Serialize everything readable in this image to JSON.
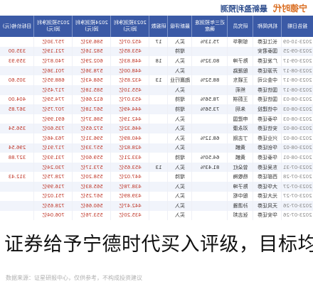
{
  "headline": "证券给予宁德时代买入评级，目标均价",
  "brand": {
    "logo": "宁德时代",
    "subtitle": "最新盈利预测"
  },
  "table": {
    "headers": [
      "报告日期",
      "机构简称",
      "研究员",
      "近三年预测准确度",
      "最新评级",
      "研报数",
      "2023预测净利润(元)",
      "2024预测净利润(元)",
      "2025预测净利润(元)",
      "目标价格(元)"
    ],
    "rows": [
      [
        "2023-10-09",
        "长江证券",
        "邬博华",
        "75.13%",
        "买入",
        "17",
        "452.07亿",
        "586.92亿",
        "757.30亿",
        ""
      ],
      [
        "2023-09-25",
        "国泰君安",
        "",
        "",
        "增持",
        "",
        "453.85亿",
        "582.16亿",
        "721.19亿",
        "335.00"
      ],
      [
        "2023-09-17",
        "广发证券",
        "陈子坤",
        "80.32%",
        "买入",
        "18",
        "448.83亿",
        "602.29亿",
        "740.87亿",
        "359.93"
      ],
      [
        "2023-08-17",
        "开源证券",
        "殷晟路",
        "",
        "买入",
        "",
        "448.00亿",
        "578.36亿",
        "701.36亿",
        ""
      ],
      [
        "2023-08-17",
        "中金公司",
        "王颖东",
        "88.52%",
        "跑赢行业",
        "13",
        "432.85亿",
        "568.43亿",
        "688.95亿",
        "305.60"
      ],
      [
        "2023-08-17",
        "国信证券",
        "熊莉",
        "",
        "买入",
        "",
        "455.10亿",
        "585.18亿",
        "717.45亿",
        ""
      ],
      [
        "2023-08-03",
        "国信证券",
        "王蔚祺",
        "78.56%",
        "增持",
        "",
        "453.07亿",
        "612.66亿",
        "774.59亿",
        "404.00"
      ],
      [
        "2023-08-03",
        "中信建投",
        "朱玥",
        "73.56%",
        "增持",
        "",
        "444.49亿",
        "567.18亿",
        "707.75亿",
        "367.85"
      ],
      [
        "2023-08-03",
        "华泰证券",
        "申建国",
        "",
        "买入",
        "",
        "442.19亿",
        "586.37亿",
        "691.99亿",
        ""
      ],
      [
        "2023-08-02",
        "安信证券",
        "邓永康",
        "",
        "买入",
        "",
        "446.32亿",
        "572.65亿",
        "735.60亿",
        "356.54"
      ],
      [
        "2023-08-02",
        "兴业证券",
        "丁志刚",
        "68.12%",
        "买入",
        "",
        "440.89亿",
        "596.31亿",
        "763.46亿",
        ""
      ],
      [
        "2023-08-02",
        "华创证券",
        "黄麟",
        "",
        "买入",
        "",
        "428.82亿",
        "557.33亿",
        "717.91亿",
        "296.54"
      ],
      [
        "2023-08-01",
        "华泰证券",
        "黄麟",
        "64.50%",
        "增持",
        "",
        "433.21亿",
        "559.60亿",
        "731.93亿",
        "327.88"
      ],
      [
        "2023-07-31",
        "东吴证券",
        "曾朵红",
        "81.43%",
        "买入",
        "13",
        "453.65亿",
        "573.17亿",
        "730.24亿",
        ""
      ],
      [
        "2023-07-28",
        "西部证券",
        "杨敬梅",
        "",
        "增持",
        "",
        "447.02亿",
        "558.20亿",
        "728.75亿",
        "312.43"
      ],
      [
        "2023-07-27",
        "大华证券",
        "陈子坤",
        "",
        "买入",
        "",
        "438.78亿",
        "565.83亿",
        "716.99亿",
        ""
      ],
      [
        "2023-07-27",
        "光大证券",
        "殷中枢",
        "",
        "买入",
        "",
        "439.89亿",
        "567.25亿",
        "751.02亿",
        ""
      ],
      [
        "2023-07-26",
        "天风证券",
        "孙潇雅",
        "",
        "买入",
        "",
        "442.47亿",
        "560.66亿",
        "728.65亿",
        ""
      ],
      [
        "2023-07-26",
        "华安证券",
        "张志邦",
        "",
        "买入",
        "",
        "435.20亿",
        "553.76亿",
        "706.04亿",
        ""
      ]
    ]
  },
  "footer": "数据来源：证星研报中心，仅供参考，不构成投资建议"
}
